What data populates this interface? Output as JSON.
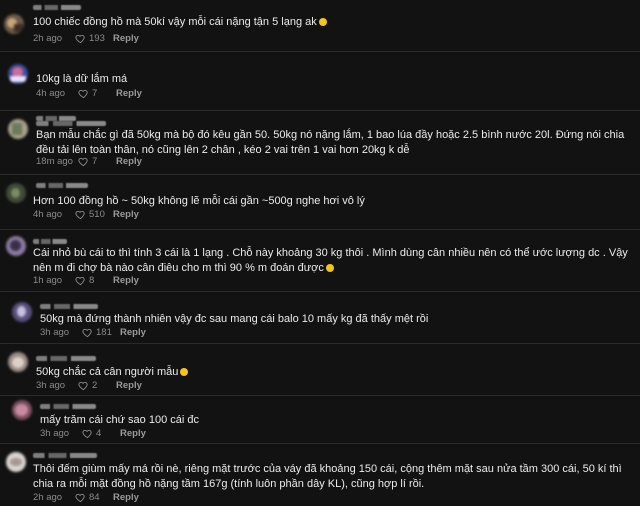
{
  "icons": {
    "like": "heart-outline-icon",
    "emoji": "laughing-emoji-icon"
  },
  "colors": {
    "background": "#121212",
    "text": "#ececec",
    "meta": "#8b8b8b",
    "emoji": "#f6c21b"
  },
  "comments": [
    {
      "text": "100 chiếc đồng hồ mà 50kí vậy mỗi cái nặng tận 5 lạng ak",
      "time": "2h ago",
      "likes": "193",
      "reply": "Reply"
    },
    {
      "text": "10kg là dữ lắm má",
      "time": "4h ago",
      "likes": "7",
      "reply": "Reply"
    },
    {
      "text": "Bạn mẫu chắc gì đã 50kg mà bộ đó kêu gần 50. 50kg nó nặng lắm, 1 bao lúa đầy hoặc 2.5 bình nước 20l. Đứng nói chia đều tải lên toàn thân, nó cũng lên 2 chân , kéo 2 vai trên 1 vai hơn 20kg k dễ",
      "time": "18m ago",
      "likes": "7",
      "reply": "Reply"
    },
    {
      "text": "Hơn 100 đồng hồ ~ 50kg không lẽ mỗi cái gần ~500g nghe hơi vô lý",
      "time": "4h ago",
      "likes": "510",
      "reply": "Reply"
    },
    {
      "text": "Cái nhỏ bù cái to thì tính 3 cái là 1 lạng . Chỗ này khoảng 30 kg thôi . Mình dùng cân nhiều nên có thể ước lượng dc . Vậy nên m đi chợ bà nào cân điêu cho m thì 90 % m đoán được",
      "time": "1h ago",
      "likes": "8",
      "reply": "Reply"
    },
    {
      "text": "50kg mà đứng thành nhiên vậy đc sau mang cái balo 10 mấy kg đã thấy mệt rồi",
      "time": "3h ago",
      "likes": "181",
      "reply": "Reply"
    },
    {
      "text": "50kg chắc cả cân người mẫu",
      "time": "3h ago",
      "likes": "2",
      "reply": "Reply"
    },
    {
      "text": "mấy trăm cái chứ sao 100 cái đc",
      "time": "3h ago",
      "likes": "4",
      "reply": "Reply"
    },
    {
      "text": "Thôi đếm giùm mấy má rồi nè, riêng mặt trước của váy đã khoảng 150 cái, cộng thêm mặt sau nửa tầm 300 cái, 50 kí thì chia ra mỗi mặt đồng hồ nặng tầm 167g (tính luôn phần dây KL), cũng hợp lí rồi.",
      "time": "2h ago",
      "likes": "84",
      "reply": "Reply"
    }
  ]
}
